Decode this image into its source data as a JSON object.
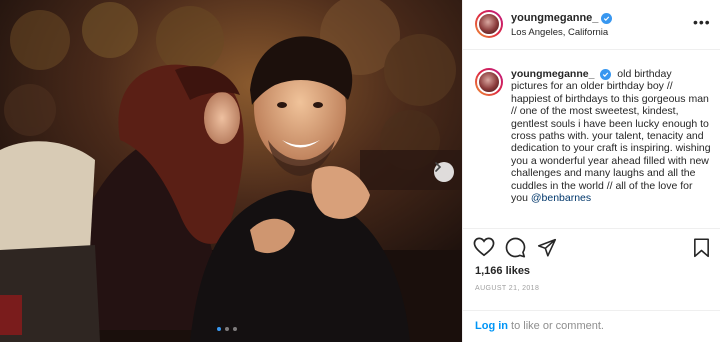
{
  "post": {
    "username": "youngmeganne_",
    "location": "Los Angeles, California",
    "caption": "old birthday pictures for an older birthday boy // happiest of birthdays to this gorgeous man // one of the most sweetest, kindest, gentlest souls i have been lucky enough to cross paths with. your talent, tenacity and dedication to your craft is inspiring. wishing you a wonderful year ahead filled with new challenges and many laughs and all the cuddles in the world // all of the love for you",
    "mention": "@benbarnes",
    "likes": "1,166 likes",
    "date": "AUGUST 21, 2018"
  },
  "carousel": {
    "count": 3,
    "active": 1
  },
  "comment_bar": {
    "login": "Log in",
    "rest": " to like or comment."
  },
  "icons": {
    "verified": "verified-badge-icon",
    "more": "more-options-icon",
    "like": "heart-icon",
    "comment": "comment-icon",
    "share": "share-icon",
    "save": "bookmark-icon",
    "next": "chevron-right-icon"
  },
  "colors": {
    "accent": "#3897f0",
    "link": "#0095f6",
    "mention": "#00376b"
  }
}
